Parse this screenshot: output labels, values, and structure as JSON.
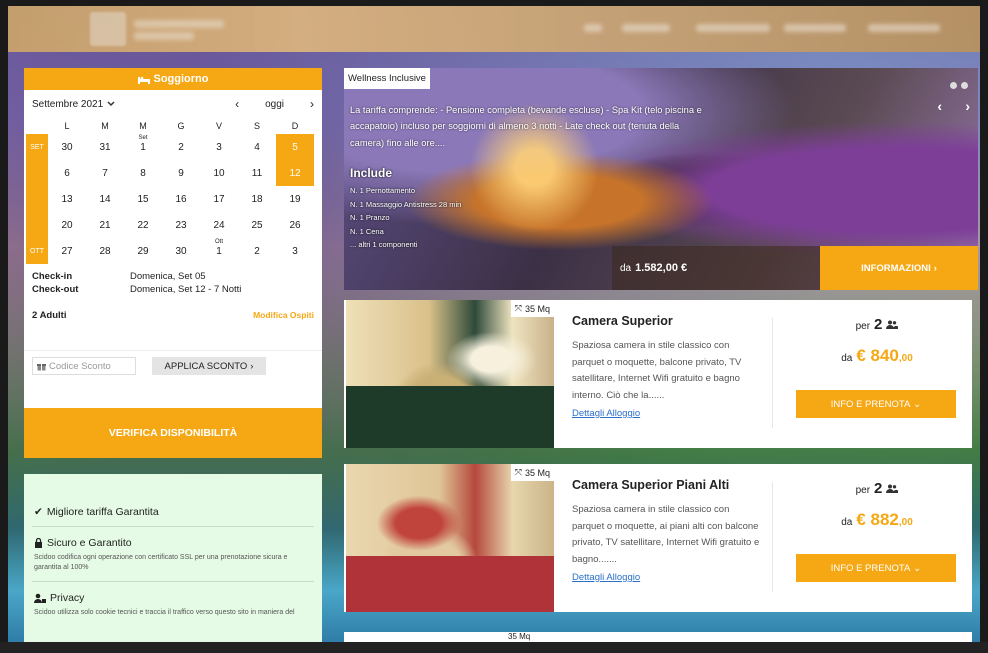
{
  "booking": {
    "title": "Soggiorno",
    "month_select": "Settembre 2021",
    "today": "oggi",
    "weekdays": [
      "L",
      "M",
      "M",
      "G",
      "V",
      "S",
      "D"
    ],
    "months": [
      "SET",
      "OTT"
    ],
    "weeks": [
      [
        "30",
        "31",
        "1",
        "2",
        "3",
        "4",
        "5"
      ],
      [
        "6",
        "7",
        "8",
        "9",
        "10",
        "11",
        "12"
      ],
      [
        "13",
        "14",
        "15",
        "16",
        "17",
        "18",
        "19"
      ],
      [
        "20",
        "21",
        "22",
        "23",
        "24",
        "25",
        "26"
      ],
      [
        "27",
        "28",
        "29",
        "30",
        "1",
        "2",
        "3"
      ]
    ],
    "sub_labels": {
      "set": "Set",
      "ott": "Ott"
    },
    "checkin_label": "Check-in",
    "checkin_value": "Domenica, Set 05",
    "checkout_label": "Check-out",
    "checkout_value": "Domenica, Set 12 - 7 Notti",
    "guests": "2 Adulti",
    "modify_guests": "Modifica Ospiti",
    "promo_placeholder": "Codice Sconto",
    "promo_button": "APPLICA SCONTO",
    "verify_button": "VERIFICA DISPONIBILITÀ"
  },
  "trust": [
    {
      "title": "Migliore tariffa Garantita",
      "desc": ""
    },
    {
      "title": "Sicuro e Garantito",
      "desc": "Scidoo codifica ogni operazione con certificato SSL per una prenotazione sicura e garantita al 100%"
    },
    {
      "title": "Privacy",
      "desc": "Scidoo utilizza solo cookie tecnici e traccia il traffico verso questo sito in maniera del"
    }
  ],
  "wellness": {
    "tag": "Wellness Inclusive",
    "description": "La tariffa comprende: - Pensione completa (bevande escluse) - Spa Kit (telo piscina e accapatoio) incluso per soggiorni di almeno 3 notti - Late check out (tenuta della camera) fino alle ore....",
    "include_title": "Include",
    "include_items": [
      "N. 1 Pernottamento",
      "N. 1 Massaggio Antistress 28 min",
      "N. 1 Pranzo",
      "N. 1 Cena",
      "... altri 1 componenti"
    ],
    "price_prefix": "da",
    "price": "1.582,00 €",
    "info_button": "INFORMAZIONI"
  },
  "rooms": [
    {
      "size": "35 Mq",
      "title": "Camera Superior",
      "desc": "Spaziosa camera in stile classico con parquet o moquette, balcone privato, TV satellitare, Internet Wifi gratuito e bagno interno. Ciò che la......",
      "link": "Dettagli Alloggio",
      "per_label": "per",
      "persons": "2",
      "from_label": "da",
      "price_main": "€ 840",
      "price_dec": ",00",
      "button": "INFO E PRENOTA"
    },
    {
      "size": "35 Mq",
      "title": "Camera Superior Piani Alti",
      "desc": "Spaziosa camera in stile classico con parquet o moquette, ai piani alti con balcone privato, TV satellitare, Internet Wifi gratuito e bagno.......",
      "link": "Dettagli Alloggio",
      "per_label": "per",
      "persons": "2",
      "from_label": "da",
      "price_main": "€ 882",
      "price_dec": ",00",
      "button": "INFO E PRENOTA"
    }
  ],
  "room3_size": "35 Mq",
  "colors": {
    "accent": "#f5a814",
    "link": "#2a6fc9",
    "trust_bg": "#e5fbe5"
  }
}
